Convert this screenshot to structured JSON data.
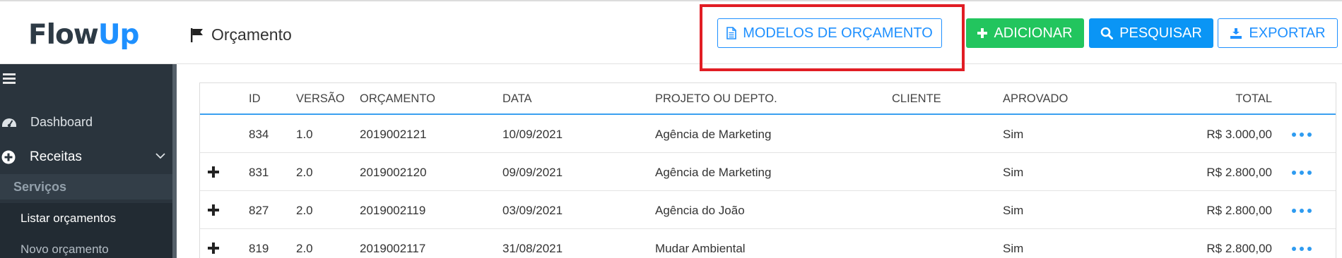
{
  "header": {
    "logo": {
      "part1": "Flow",
      "part2": "Up"
    },
    "page_title": "Orçamento",
    "buttons": {
      "models": "MODELOS DE ORÇAMENTO",
      "add": "ADICIONAR",
      "search": "PESQUISAR",
      "export": "EXPORTAR"
    }
  },
  "sidebar": {
    "dashboard": "Dashboard",
    "receitas": "Receitas",
    "section": "Serviços",
    "active_item": "Listar orçamentos",
    "next_item": "Novo orçamento"
  },
  "table": {
    "columns": [
      "ID",
      "VERSÃO",
      "ORÇAMENTO",
      "DATA",
      "PROJETO OU DEPTO.",
      "CLIENTE",
      "APROVADO",
      "TOTAL"
    ],
    "rows": [
      {
        "id": "834",
        "versao": "1.0",
        "orcamento": "2019002121",
        "data": "10/09/2021",
        "projeto": "Agência de Marketing",
        "cliente": "",
        "aprovado": "Sim",
        "total": "R$ 3.000,00",
        "expandable": false
      },
      {
        "id": "831",
        "versao": "2.0",
        "orcamento": "2019002120",
        "data": "09/09/2021",
        "projeto": "Agência de Marketing",
        "cliente": "",
        "aprovado": "Sim",
        "total": "R$ 2.800,00",
        "expandable": true
      },
      {
        "id": "827",
        "versao": "2.0",
        "orcamento": "2019002119",
        "data": "03/09/2021",
        "projeto": "Agência do João",
        "cliente": "",
        "aprovado": "Sim",
        "total": "R$ 2.800,00",
        "expandable": true
      },
      {
        "id": "819",
        "versao": "2.0",
        "orcamento": "2019002117",
        "data": "31/08/2021",
        "projeto": "Mudar Ambiental",
        "cliente": "",
        "aprovado": "Sim",
        "total": "R$ 2.800,00",
        "expandable": true
      }
    ]
  },
  "colors": {
    "accent": "#1e90ff",
    "add_green": "#22c55e",
    "search_blue": "#0a95f5",
    "sidebar_bg": "#2a343d",
    "highlight_red": "#e11d24"
  }
}
